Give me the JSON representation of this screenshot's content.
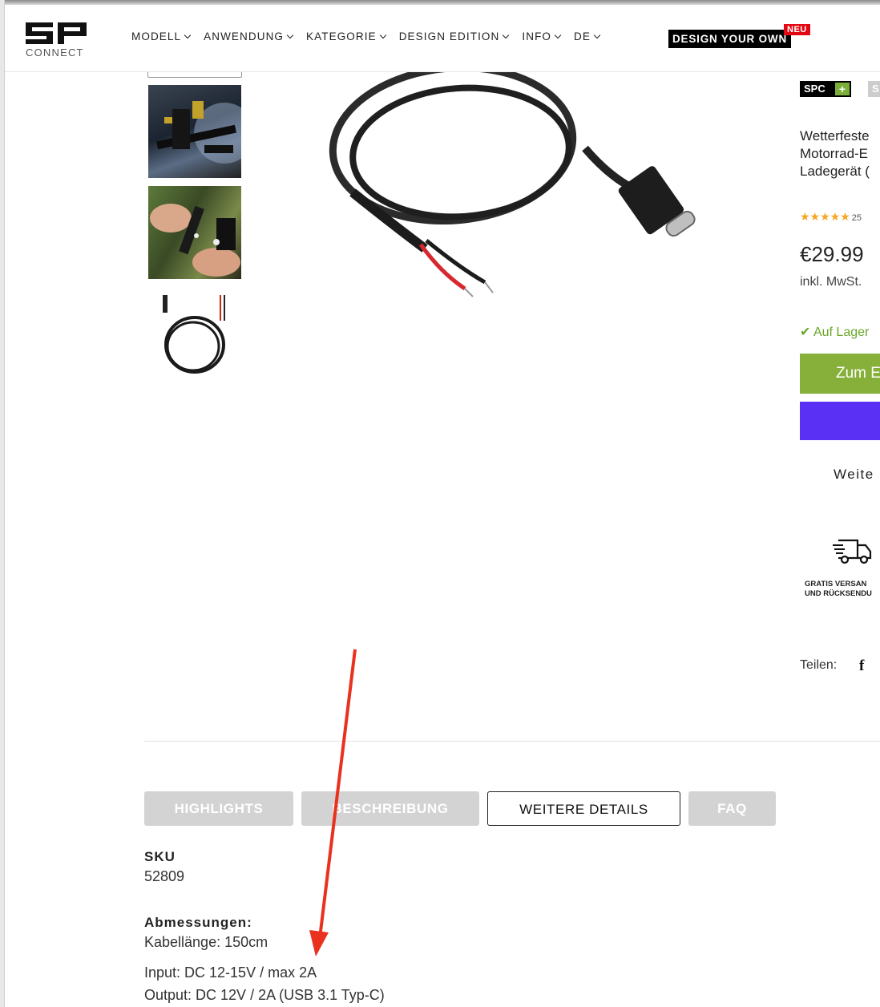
{
  "header": {
    "logo_text": "CONNECT",
    "logo_mark": "SP",
    "nav": [
      {
        "label": "MODELL"
      },
      {
        "label": "ANWENDUNG"
      },
      {
        "label": "KATEGORIE"
      },
      {
        "label": "DESIGN EDITION"
      },
      {
        "label": "INFO"
      },
      {
        "label": "DE"
      }
    ],
    "design_button": "DESIGN YOUR OWN",
    "new_badge": "NEU"
  },
  "product": {
    "badge_primary": "SPC",
    "badge_secondary": "S",
    "title_lines": [
      "Wetterfeste",
      "Motorrad-E",
      "Ladegerät ("
    ],
    "rating_stars": "★★★★★",
    "rating_count": "25",
    "price": "€29.99",
    "vat": "inkl. MwSt.",
    "stock": "Auf Lager",
    "cart_button": "Zum E",
    "more_link": "Weite",
    "shipping_line1": "GRATIS VERSAN",
    "shipping_line2": "UND RÜCKSENDU",
    "share_label": "Teilen:",
    "share_icon": "f"
  },
  "tabs": [
    {
      "label": "HIGHLIGHTS",
      "active": false
    },
    {
      "label": "BESCHREIBUNG",
      "active": false
    },
    {
      "label": "WEITERE DETAILS",
      "active": true
    },
    {
      "label": "FAQ",
      "active": false
    }
  ],
  "details": {
    "sku_label": "SKU",
    "sku_value": "52809",
    "dimensions_label": "Abmessungen:",
    "cable_length": "Kabellänge: 150cm",
    "input": "Input: DC 12-15V / max 2A",
    "output": "Output: DC 12V / 2A (USB 3.1 Typ-C)"
  },
  "colors": {
    "accent_green": "#87b03a",
    "pay_purple": "#5a31f4",
    "badge_red": "#e30613",
    "annotation_red": "#e8321e"
  },
  "icons": [
    "chevron-down-icon",
    "check-icon",
    "truck-icon",
    "facebook-icon",
    "star-icon"
  ]
}
